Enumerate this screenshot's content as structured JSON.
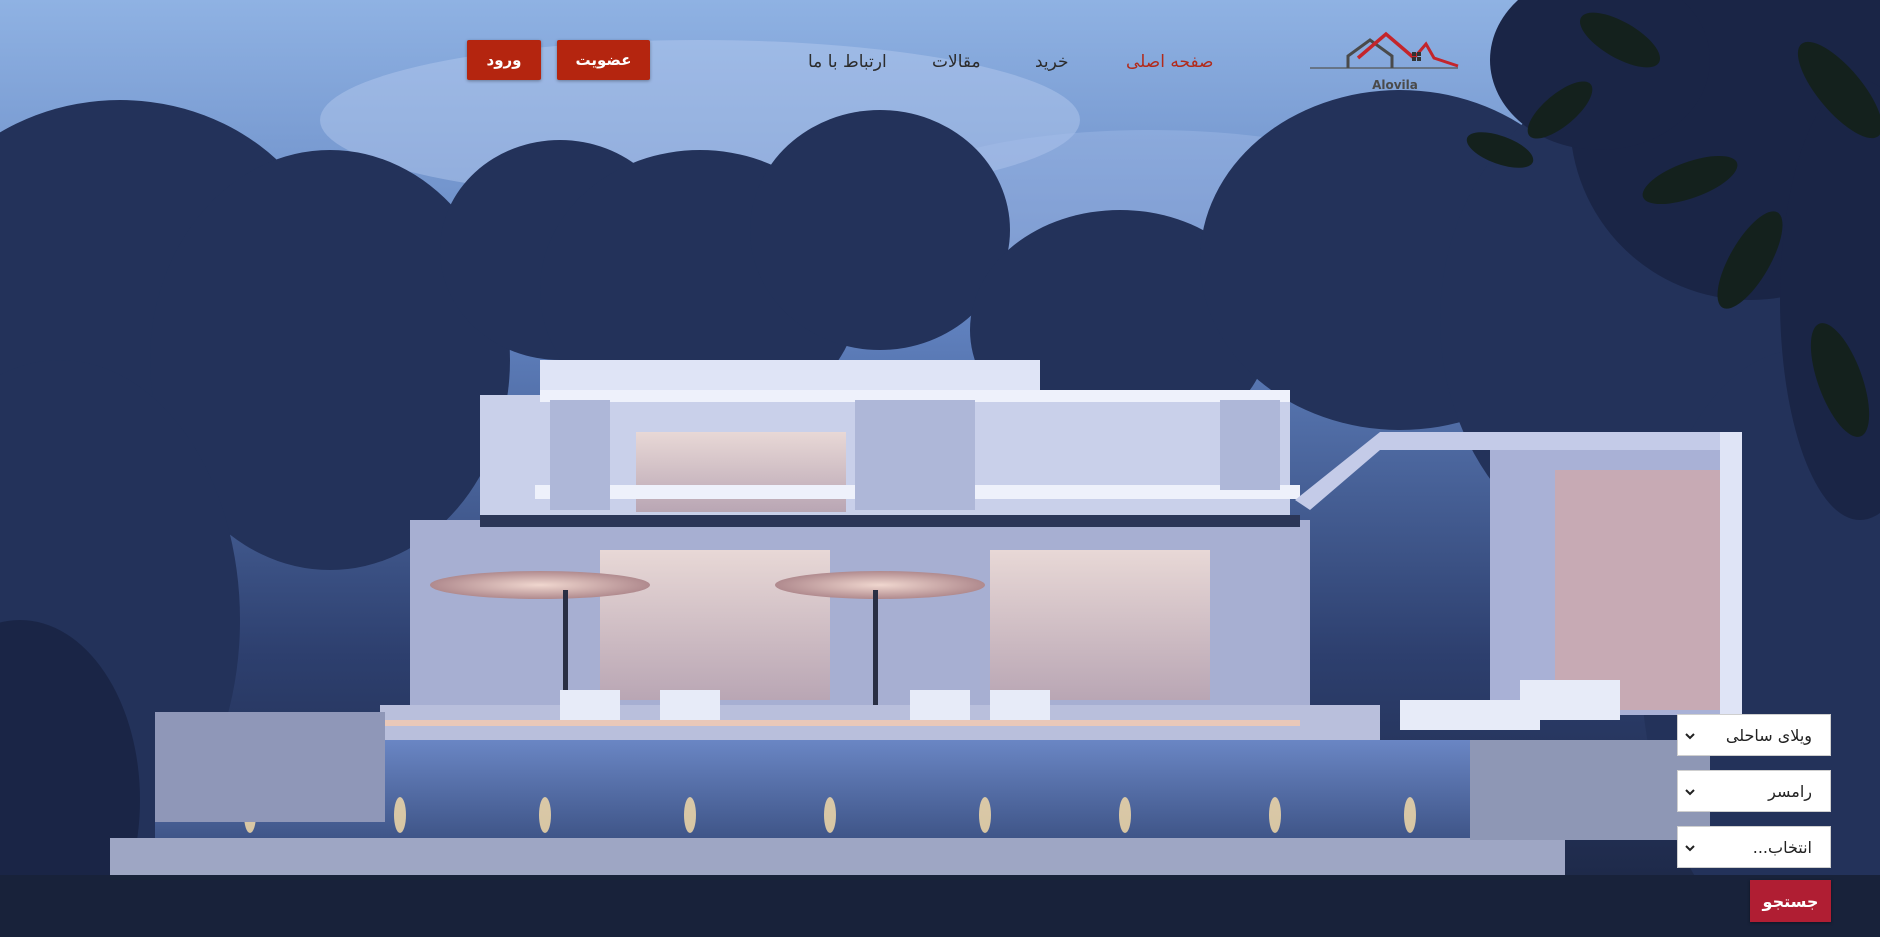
{
  "brand": {
    "name": "Alovila",
    "logo_icon": "house-roof-logo-icon",
    "accent_color": "#b4250f"
  },
  "nav": {
    "home": "صفحه اصلی",
    "buy": "خرید",
    "articles": "مقالات",
    "contact": "ارتباط با ما"
  },
  "auth": {
    "signup_label": "عضویت",
    "login_label": "ورود"
  },
  "search": {
    "type_value": "ویلای ساحلی",
    "city_value": "رامسر",
    "option_value": "انتخاب...",
    "submit_label": "جستجو",
    "chevron_icon": "chevron-down-icon"
  }
}
